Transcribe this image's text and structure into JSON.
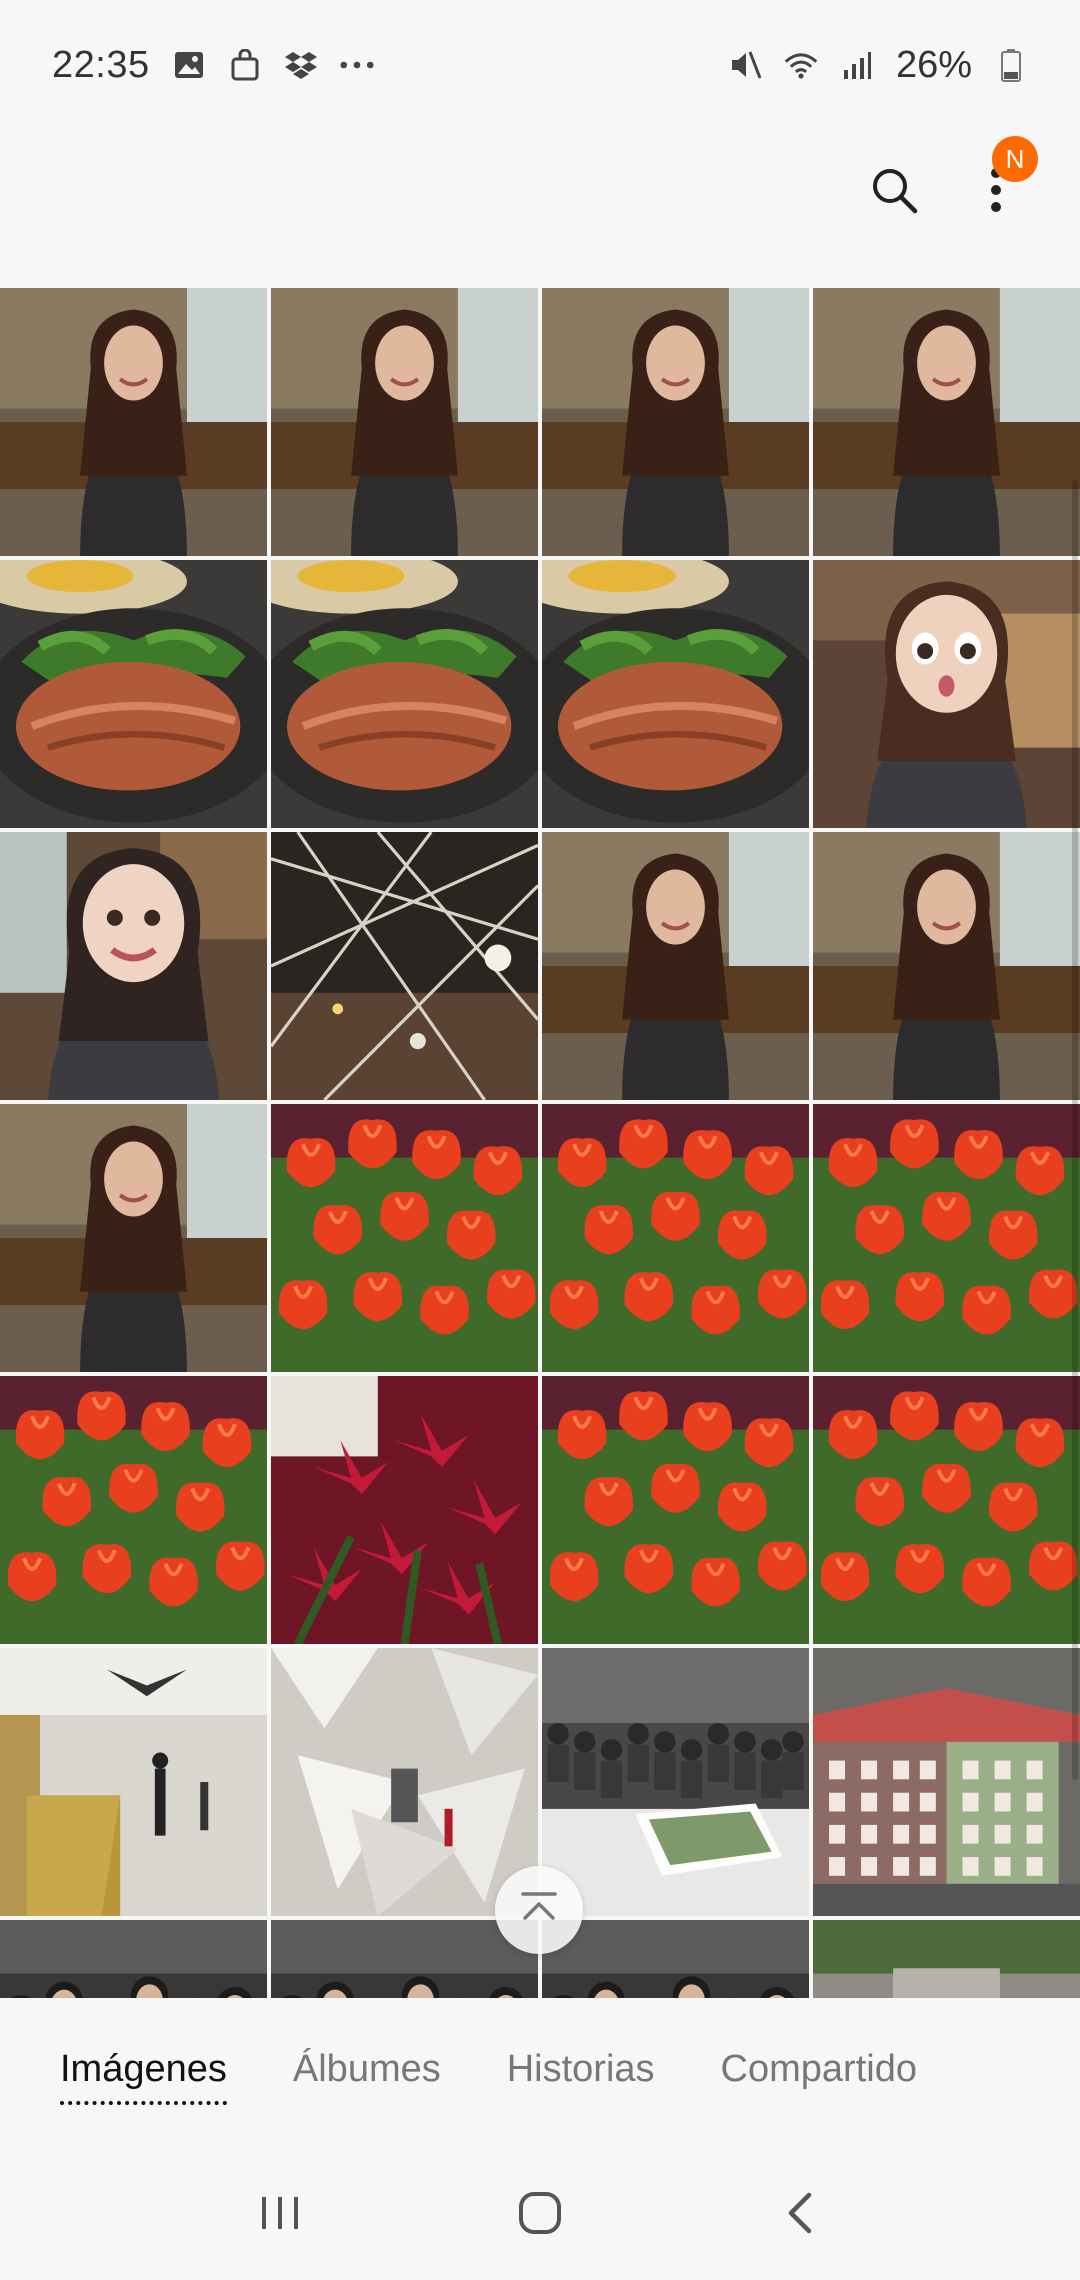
{
  "status_bar": {
    "time": "22:35",
    "battery": "26%",
    "icons_left": [
      "gallery-icon",
      "bag-icon",
      "dropbox-icon",
      "more-notifications-icon"
    ],
    "icons_right": [
      "mute-icon",
      "wifi-icon",
      "signal-icon",
      "battery-icon"
    ]
  },
  "top_bar": {
    "badge": "N",
    "icons": [
      "search-icon",
      "more-options-icon"
    ]
  },
  "grid": {
    "rows": [
      [
        "portrait",
        "portrait",
        "portrait",
        "portrait"
      ],
      [
        "steak",
        "steak",
        "steak",
        "avatar-surprised"
      ],
      [
        "avatar-smile",
        "ceiling-lights",
        "portrait",
        "portrait"
      ],
      [
        "portrait",
        "tulips",
        "tulips",
        "tulips"
      ],
      [
        "tulips",
        "red-lilies",
        "tulips",
        "tulips"
      ],
      [
        "lobby",
        "mirror-art",
        "model-display",
        "building-model"
      ],
      [
        "crowd",
        "crowd",
        "crowd",
        "city-model"
      ]
    ]
  },
  "tabs": {
    "items": [
      "Imágenes",
      "Álbumes",
      "Historias",
      "Compartido"
    ],
    "active": "Imágenes"
  },
  "nav_bar": {
    "icons": [
      "recent-apps-icon",
      "home-icon",
      "back-icon"
    ]
  },
  "colors": {
    "accent_badge": "#ff6a00",
    "background": "#f7f7f7"
  }
}
